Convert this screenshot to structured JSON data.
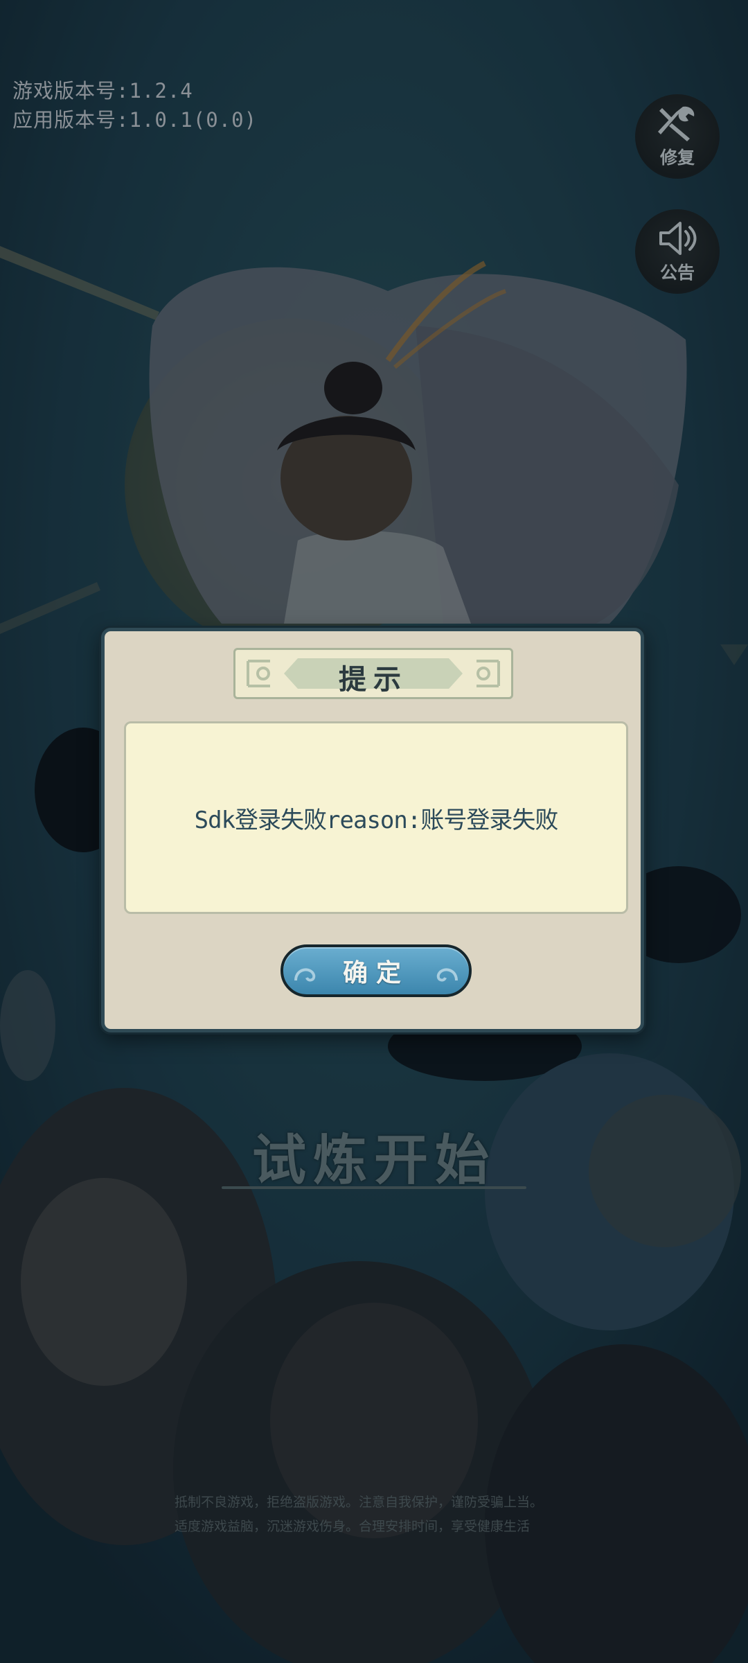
{
  "version_info": {
    "game_version": "游戏版本号:1.2.4",
    "app_version": "应用版本号:1.0.1(0.0)"
  },
  "side_buttons": [
    {
      "label": "修复",
      "icon": "wrench-hammer-icon"
    },
    {
      "label": "公告",
      "icon": "speaker-icon"
    }
  ],
  "start_title": "试炼开始",
  "health_notice": {
    "line1": "抵制不良游戏，拒绝盗版游戏。注意自我保护，谨防受骗上当。",
    "line2": "适度游戏益脑，沉迷游戏伤身。合理安排时间，享受健康生活"
  },
  "dialog": {
    "title": "提示",
    "message": "Sdk登录失败reason:账号登录失败",
    "confirm_label": "确定"
  },
  "colors": {
    "dialog_bg": "#dcd5c3",
    "dialog_content_bg": "#f7f3d3",
    "confirm_button": "#4a93bb",
    "dialog_border": "#2f4a55"
  }
}
